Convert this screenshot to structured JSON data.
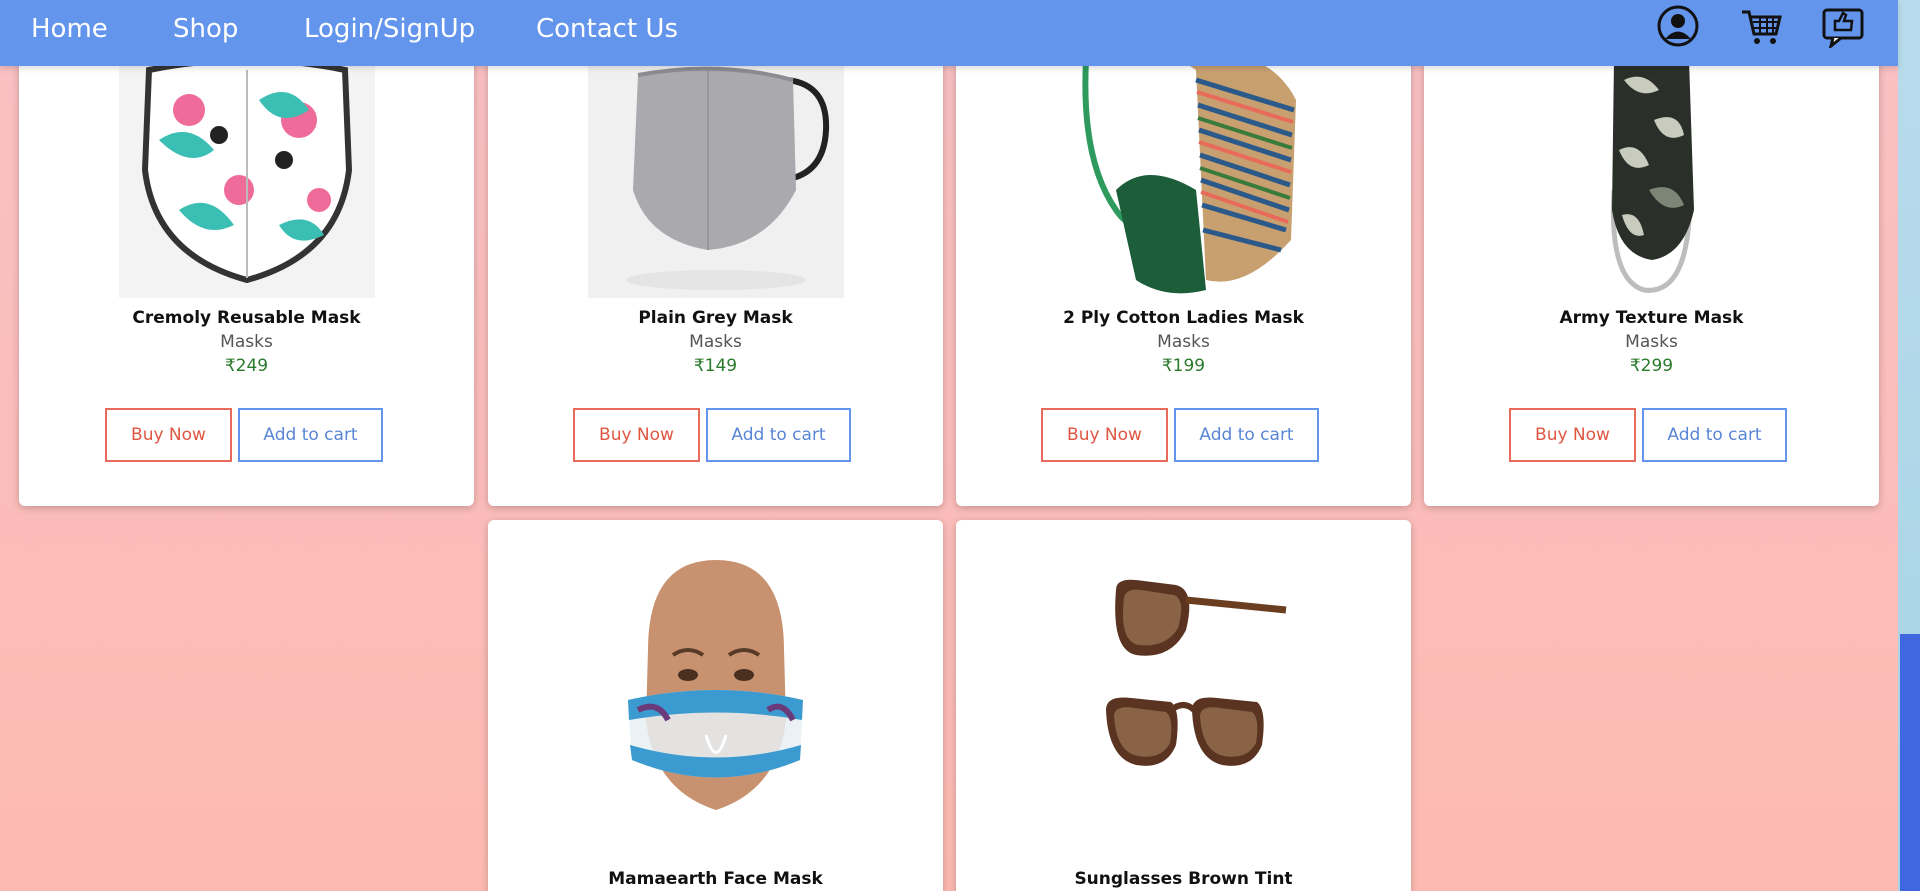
{
  "nav": {
    "links": [
      "Home",
      "Shop",
      "Login/SignUp",
      "Contact Us"
    ],
    "icons": [
      "user-icon",
      "cart-icon",
      "feedback-icon"
    ]
  },
  "buttons": {
    "buy": "Buy Now",
    "cart": "Add to cart"
  },
  "products": [
    {
      "name": "Cremoly Reusable Mask",
      "category": "Masks",
      "price": "₹249",
      "image": "floral-mask"
    },
    {
      "name": "Plain Grey Mask",
      "category": "Masks",
      "price": "₹149",
      "image": "grey-mask"
    },
    {
      "name": "2 Ply Cotton Ladies Mask",
      "category": "Masks",
      "price": "₹199",
      "image": "striped-mask"
    },
    {
      "name": "Army Texture Mask",
      "category": "Masks",
      "price": "₹299",
      "image": "camo-mask"
    },
    {
      "name": "Mamaearth Face Mask",
      "category": "",
      "price": "",
      "image": "mannequin-mask"
    },
    {
      "name": "Sunglasses Brown Tint",
      "category": "",
      "price": "",
      "image": "sunglasses"
    }
  ],
  "colors": {
    "nav": "#6495ed",
    "buy": "#e05542",
    "cart": "#5a86d8",
    "price": "#2a7a2a"
  }
}
